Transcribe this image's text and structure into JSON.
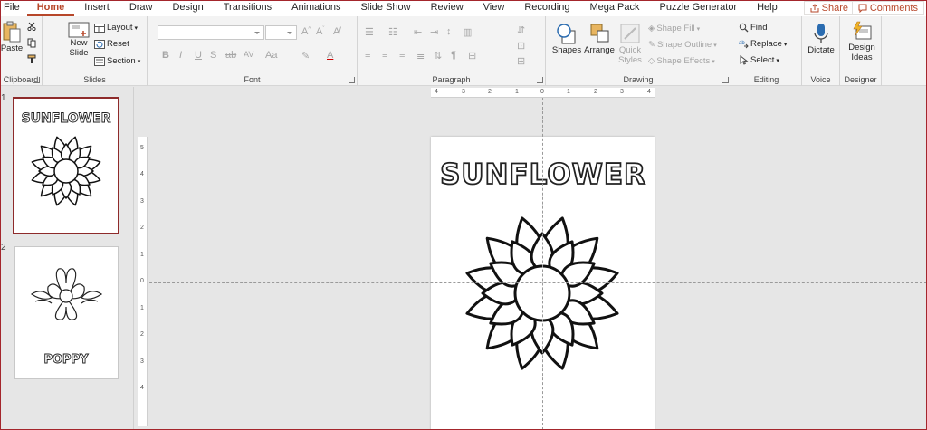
{
  "tabs": [
    "File",
    "Home",
    "Insert",
    "Draw",
    "Design",
    "Transitions",
    "Animations",
    "Slide Show",
    "Review",
    "View",
    "Recording",
    "Mega Pack",
    "Puzzle Generator",
    "Help"
  ],
  "active_tab": "Home",
  "share": "Share",
  "comments": "Comments",
  "ribbon": {
    "clipboard": {
      "paste": "Paste",
      "label": "Clipboard"
    },
    "slides": {
      "new_slide_1": "New",
      "new_slide_2": "Slide",
      "layout": "Layout",
      "reset": "Reset",
      "section": "Section",
      "label": "Slides"
    },
    "font": {
      "label": "Font"
    },
    "paragraph": {
      "label": "Paragraph"
    },
    "drawing": {
      "shapes": "Shapes",
      "arrange": "Arrange",
      "quick_styles_1": "Quick",
      "quick_styles_2": "Styles",
      "shape_fill": "Shape Fill",
      "shape_outline": "Shape Outline",
      "shape_effects": "Shape Effects",
      "label": "Drawing"
    },
    "editing": {
      "find": "Find",
      "replace": "Replace",
      "select": "Select",
      "label": "Editing"
    },
    "voice": {
      "dictate": "Dictate",
      "label": "Voice"
    },
    "designer": {
      "design_ideas_1": "Design",
      "design_ideas_2": "Ideas",
      "label": "Designer"
    }
  },
  "slides": [
    {
      "number": "1",
      "title": "SUNFLOWER"
    },
    {
      "number": "2",
      "title": "POPPY"
    }
  ],
  "rulers": {
    "horizontal": [
      "4",
      "3",
      "2",
      "1",
      "0",
      "1",
      "2",
      "3",
      "4"
    ],
    "vertical": [
      "5",
      "4",
      "3",
      "2",
      "1",
      "0",
      "1",
      "2",
      "3",
      "4"
    ]
  },
  "slide_title": "SUNFLOWER",
  "colors": {
    "accent": "#b7472a",
    "selection": "#8e2b2b"
  }
}
